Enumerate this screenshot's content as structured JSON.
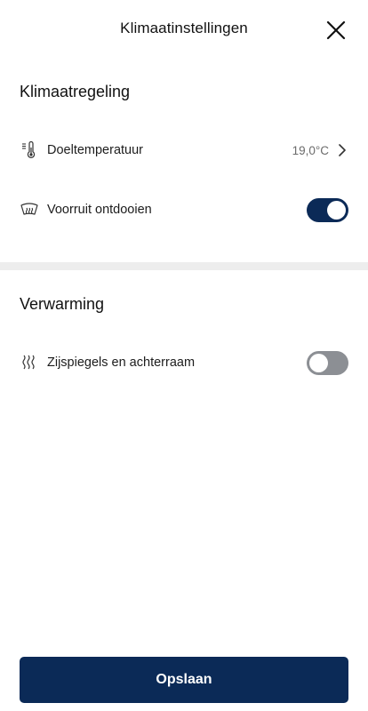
{
  "header": {
    "title": "Klimaatinstellingen",
    "close_icon": "close-icon"
  },
  "sections": [
    {
      "title": "Klimaatregeling",
      "items": [
        {
          "icon": "thermometer-icon",
          "label": "Doeltemperatuur",
          "value": "19,0°C",
          "type": "navigation"
        },
        {
          "icon": "windshield-defrost-icon",
          "label": "Voorruit ontdooien",
          "type": "toggle",
          "enabled": true
        }
      ]
    },
    {
      "title": "Verwarming",
      "items": [
        {
          "icon": "heat-waves-icon",
          "label": "Zijspiegels en achterraam",
          "type": "toggle",
          "enabled": false
        }
      ]
    }
  ],
  "footer": {
    "save_label": "Opslaan"
  },
  "colors": {
    "primary": "#0b2a57",
    "toggle_off": "#8c8f94",
    "divider": "#ededed",
    "value_text": "#6b6b6b"
  }
}
